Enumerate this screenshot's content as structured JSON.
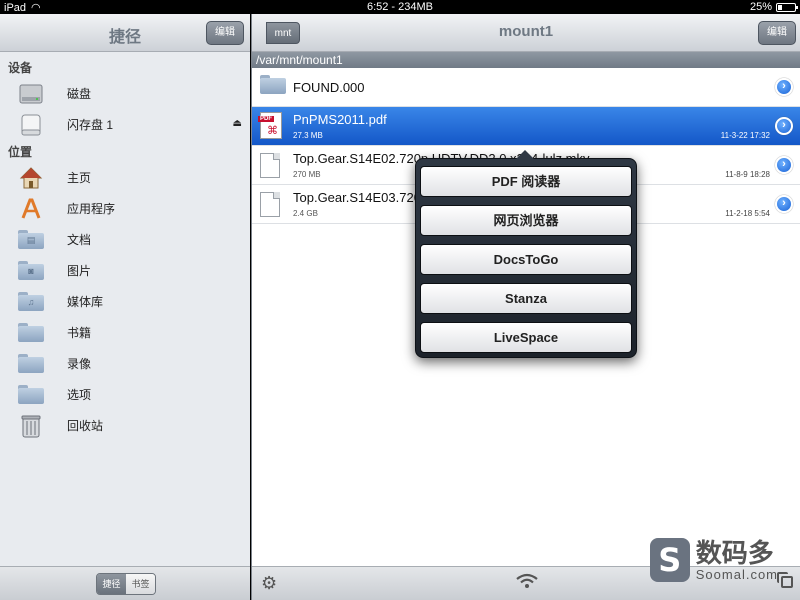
{
  "status_bar": {
    "device": "iPad",
    "time_info": "6:52 - 234MB",
    "battery_percent": "25%",
    "battery_level": 0.25
  },
  "sidebar": {
    "title": "捷径",
    "edit_label": "编辑",
    "sections": [
      {
        "header": "设备",
        "items": [
          {
            "label": "磁盘",
            "icon": "hard-disk-icon"
          },
          {
            "label": "闪存盘 1",
            "icon": "flash-drive-icon",
            "eject": "⏏"
          }
        ]
      },
      {
        "header": "位置",
        "items": [
          {
            "label": "主页",
            "icon": "home-icon"
          },
          {
            "label": "应用程序",
            "icon": "applications-icon"
          },
          {
            "label": "文档",
            "icon": "documents-folder-icon"
          },
          {
            "label": "图片",
            "icon": "pictures-folder-icon"
          },
          {
            "label": "媒体库",
            "icon": "music-folder-icon"
          },
          {
            "label": "书籍",
            "icon": "books-folder-icon"
          },
          {
            "label": "录像",
            "icon": "movies-folder-icon"
          },
          {
            "label": "选项",
            "icon": "options-folder-icon"
          },
          {
            "label": "回收站",
            "icon": "trash-icon"
          }
        ]
      }
    ],
    "segment": {
      "shortcuts": "捷径",
      "bookmarks": "书签"
    }
  },
  "main": {
    "back_label": "mnt",
    "title": "mount1",
    "edit_label": "编辑",
    "path": "/var/mnt/mount1",
    "files": [
      {
        "name": "FOUND.000",
        "type": "folder",
        "size": "",
        "date": ""
      },
      {
        "name": "PnPMS2011.pdf",
        "type": "pdf",
        "size": "27.3 MB",
        "date": "11-3-22 17:32",
        "selected": true
      },
      {
        "name": "Top.Gear.S14E02.720p.HDTV.DD2.0.x264-lulz.mkv",
        "type": "file",
        "size": "270 MB",
        "date": "11-8-9 18:28"
      },
      {
        "name": "Top.Gear.S14E03.720p.HDTV.DD2.0.x264-lulz.mkv",
        "type": "file",
        "size": "2.4 GB",
        "date": "11-2-18 5:54"
      }
    ]
  },
  "popover": {
    "options": [
      "PDF 阅读器",
      "网页浏览器",
      "DocsToGo",
      "Stanza",
      "LiveSpace"
    ]
  },
  "watermark": {
    "cn": "数码多",
    "en": "Soomal.com"
  }
}
